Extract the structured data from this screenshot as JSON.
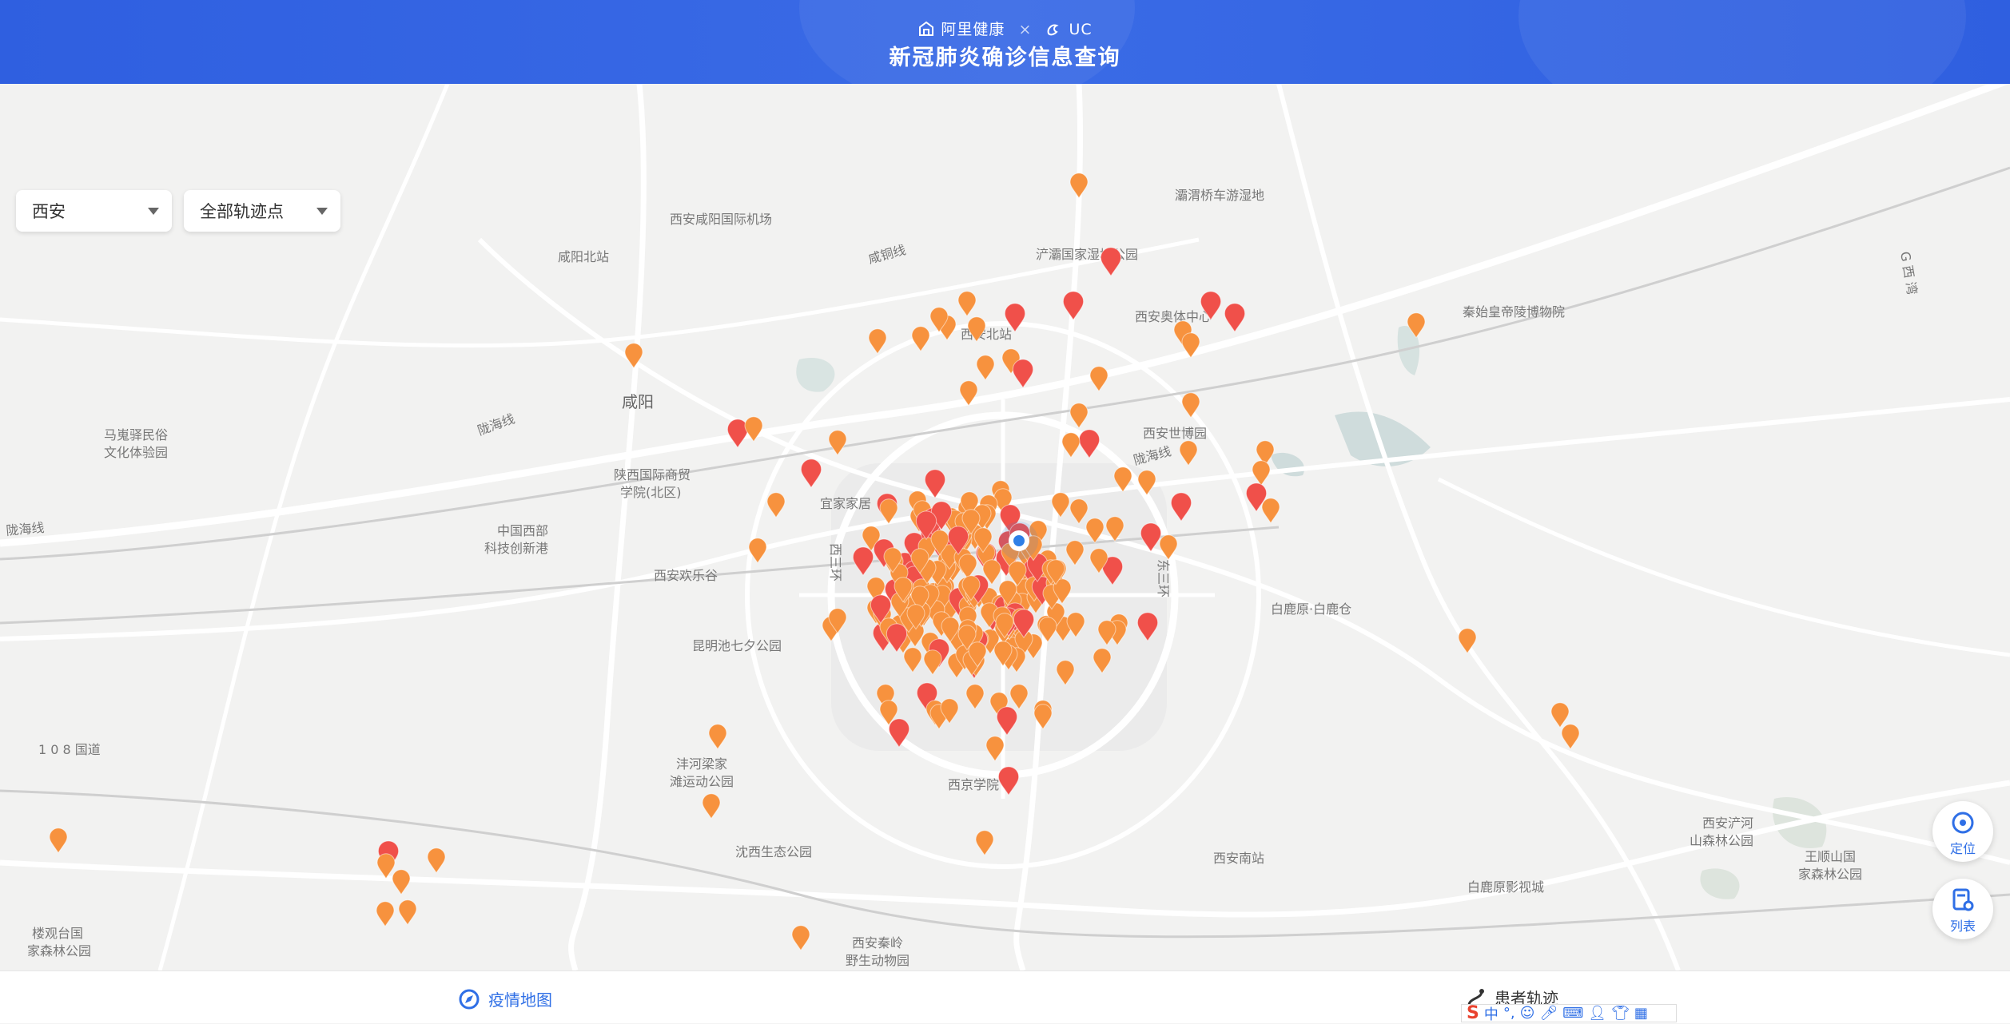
{
  "header": {
    "brand_left": "阿里健康",
    "brand_sep": "×",
    "brand_right": "UC",
    "title": "新冠肺炎确诊信息查询"
  },
  "filters": {
    "city": "西安",
    "track": "全部轨迹点"
  },
  "map": {
    "labels": {
      "l1": "灞渭桥车游湿地",
      "l2": "西安咸阳国际机场",
      "l3": "咸阳北站",
      "l4": "咸铜线",
      "l5": "浐灞国家湿地公园",
      "l6": "西安奥体中心",
      "l7": "秦始皇帝陵博物院",
      "l8": "西安北站",
      "l9": "咸阳",
      "l10": "陇海线",
      "l11": "马嵬驿民俗",
      "l12": "文化体验园",
      "l13": "西安世博园",
      "l14": "陇海线",
      "l15": "陕西国际商贸",
      "l16": "学院(北区)",
      "l17": "宜家家居",
      "l18": "陇海线",
      "l19": "中国西部",
      "l20": "科技创新港",
      "l21": "西安欢乐谷",
      "l22": "西三环",
      "l23": "东三环",
      "l24": "白鹿原·白鹿仓",
      "l25": "昆明池七夕公园",
      "l26": "1 0 8 国道",
      "l27": "沣河梁家",
      "l28": "滩运动公园",
      "l29": "西京学院",
      "l30": "沈西生态公园",
      "l31": "西安南站",
      "l32": "白鹿原影视城",
      "l33": "西安浐河",
      "l34": "山森林公园",
      "l35": "王顺山国",
      "l36": "家森林公园",
      "l37": "楼观台国",
      "l38": "家森林公园",
      "l39": "西安秦岭",
      "l40": "野生动物园",
      "l41": "G 西 湾",
      "l42": "西安北站"
    },
    "markers": {
      "orange": "#f7923e",
      "red": "#f0504a",
      "center": "#2f7fe6"
    }
  },
  "controls": {
    "locate": "定位",
    "list": "列表"
  },
  "bottom": {
    "tab_map": "疫情地图",
    "tab_track": "患者轨迹"
  },
  "ime": {
    "logo": "S",
    "mode": "中"
  }
}
